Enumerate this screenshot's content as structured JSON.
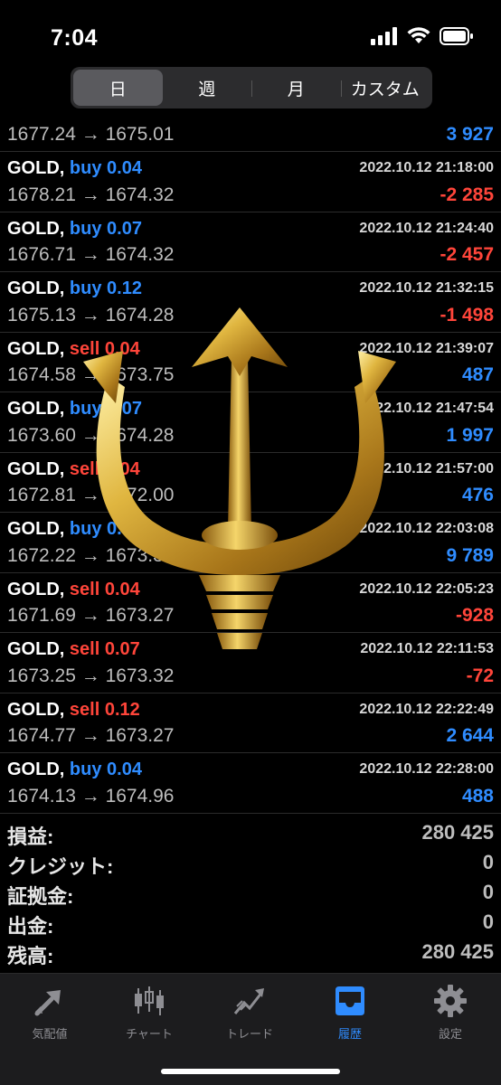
{
  "status": {
    "time": "7:04"
  },
  "period_tabs": [
    {
      "label": "日",
      "active": true
    },
    {
      "label": "週",
      "active": false
    },
    {
      "label": "月",
      "active": false
    },
    {
      "label": "カスタム",
      "active": false
    }
  ],
  "history": {
    "first_partial": {
      "price": "1677.24 → 1675.01",
      "profit": "3 927",
      "profit_sign": "pos"
    },
    "rows": [
      {
        "symbol": "GOLD,",
        "side": "buy 0.04",
        "side_type": "buy",
        "date": "2022.10.12 21:18:00",
        "price": "1678.21 → 1674.32",
        "profit": "-2 285",
        "profit_sign": "neg"
      },
      {
        "symbol": "GOLD,",
        "side": "buy 0.07",
        "side_type": "buy",
        "date": "2022.10.12 21:24:40",
        "price": "1676.71 → 1674.32",
        "profit": "-2 457",
        "profit_sign": "neg"
      },
      {
        "symbol": "GOLD,",
        "side": "buy 0.12",
        "side_type": "buy",
        "date": "2022.10.12 21:32:15",
        "price": "1675.13 → 1674.28",
        "profit": "-1 498",
        "profit_sign": "neg"
      },
      {
        "symbol": "GOLD,",
        "side": "sell 0.04",
        "side_type": "sell",
        "date": "2022.10.12 21:39:07",
        "price": "1674.58 → 1673.75",
        "profit": "487",
        "profit_sign": "pos"
      },
      {
        "symbol": "GOLD,",
        "side": "buy 0.07",
        "side_type": "buy",
        "date": "2022.10.12 21:47:54",
        "price": "1673.60 → 1674.28",
        "profit": "1 997",
        "profit_sign": "pos"
      },
      {
        "symbol": "GOLD,",
        "side": "sell 0.04",
        "side_type": "sell",
        "date": "2022.10.12 21:57:00",
        "price": "1672.81 → 1672.00",
        "profit": "476",
        "profit_sign": "pos"
      },
      {
        "symbol": "GOLD,",
        "side": "buy 0.12",
        "side_type": "buy",
        "date": "2022.10.12 22:03:08",
        "price": "1672.22 → 1673.32",
        "profit": "9 789",
        "profit_sign": "pos"
      },
      {
        "symbol": "GOLD,",
        "side": "sell 0.04",
        "side_type": "sell",
        "date": "2022.10.12 22:05:23",
        "price": "1671.69 → 1673.27",
        "profit": "-928",
        "profit_sign": "neg"
      },
      {
        "symbol": "GOLD,",
        "side": "sell 0.07",
        "side_type": "sell",
        "date": "2022.10.12 22:11:53",
        "price": "1673.25 → 1673.32",
        "profit": "-72",
        "profit_sign": "neg"
      },
      {
        "symbol": "GOLD,",
        "side": "sell 0.12",
        "side_type": "sell",
        "date": "2022.10.12 22:22:49",
        "price": "1674.77 → 1673.27",
        "profit": "2 644",
        "profit_sign": "pos"
      },
      {
        "symbol": "GOLD,",
        "side": "buy 0.04",
        "side_type": "buy",
        "date": "2022.10.12 22:28:00",
        "price": "1674.13 → 1674.96",
        "profit": "488",
        "profit_sign": "pos"
      }
    ]
  },
  "summary": [
    {
      "label": "損益:",
      "value": "280 425"
    },
    {
      "label": "クレジット:",
      "value": "0"
    },
    {
      "label": "証拠金:",
      "value": "0"
    },
    {
      "label": "出金:",
      "value": "0"
    },
    {
      "label": "残高:",
      "value": "280 425"
    }
  ],
  "tabbar": [
    {
      "label": "気配値",
      "icon": "quotes-icon",
      "active": false
    },
    {
      "label": "チャート",
      "icon": "candlestick-chart-icon",
      "active": false
    },
    {
      "label": "トレード",
      "icon": "trade-chart-icon",
      "active": false
    },
    {
      "label": "履歴",
      "icon": "history-inbox-icon",
      "active": true
    },
    {
      "label": "設定",
      "icon": "gear-icon",
      "active": false
    }
  ],
  "colors": {
    "buy": "#2f8cff",
    "sell": "#ff453a",
    "background": "#000000",
    "tabbar": "#1c1c1e",
    "overlay": "#c9a13a"
  },
  "overlay": {
    "icon": "golden-trident-icon"
  }
}
